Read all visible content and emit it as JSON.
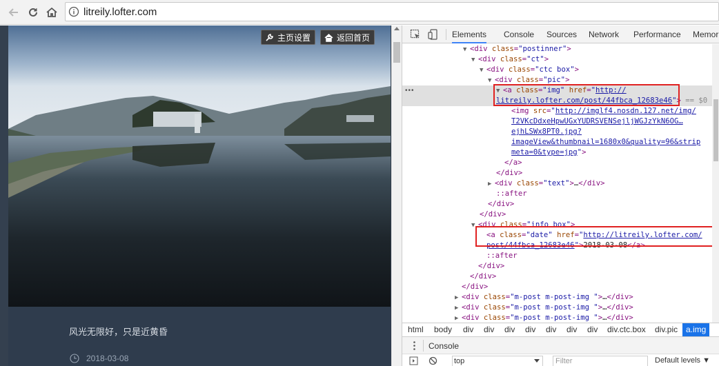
{
  "browser": {
    "url": "litreily.lofter.com"
  },
  "page": {
    "buttons": {
      "settings": "主页设置",
      "home": "返回首页"
    },
    "post_text": "风光无限好，只是近黄昏",
    "post_date": "2018-03-08"
  },
  "devtools": {
    "tabs": [
      "Elements",
      "Console",
      "Sources",
      "Network",
      "Performance",
      "Memor"
    ],
    "active_tab": "Elements",
    "dom": {
      "l1": {
        "tag": "div",
        "attr": "class",
        "val": "\"postinner\""
      },
      "l2": {
        "tag": "div",
        "attr": "class",
        "val": "\"ct\""
      },
      "l3": {
        "tag": "div",
        "attr": "class",
        "val": "\"ctc box\""
      },
      "l4": {
        "tag": "div",
        "attr": "class",
        "val": "\"pic\""
      },
      "l5": {
        "attr1": "class",
        "val1": "\"img\"",
        "attr2": "href",
        "href_a": "http://",
        "href_b": "litreily.lofter.com/post/44fbca_12683e46",
        "eq0": "== $0"
      },
      "l6": {
        "attr": "src",
        "src_a": "http://imglf4.nosdn.127.net/img/",
        "src_b": "T2VKcDdxeHpwUGxYUDRSVENSejljWGJzYkN6OG…",
        "src_c": "ejhLSWx8PT0.jpg?",
        "src_d": "imageView&thumbnail=1680x0&quality=96&strip",
        "src_e": "meta=0&type=jpg"
      },
      "l7": {
        "attr": "class",
        "val": "\"text\"",
        "ellipsis": "…"
      },
      "l8": {
        "pseudo": "::after"
      },
      "l9": {
        "attr": "class",
        "val": "\"info box\""
      },
      "l10": {
        "attr1": "class",
        "val1": "\"date\"",
        "attr2": "href",
        "href_a": "http://litreily.lofter.com/",
        "href_b": "post/44fbca_12683e46",
        "text": "2018-03-08"
      },
      "l11": {
        "pseudo": "::after"
      },
      "mpost": {
        "attr": "class",
        "val": "\"m-post m-post-img   \"",
        "ellipsis": "…"
      }
    },
    "breadcrumbs": [
      "html",
      "body",
      "div",
      "div",
      "div",
      "div",
      "div",
      "div",
      "div",
      "div.ctc.box",
      "div.pic",
      "a.img"
    ],
    "drawer_label": "Console",
    "console": {
      "context": "top",
      "filter_placeholder": "Filter",
      "levels": "Default levels ▼"
    }
  },
  "colors": {
    "highlight_box": "#e02020",
    "active_tab_underline": "#3e82f7",
    "active_crumb": "#1a73e8",
    "page_bg": "#2f3c4d"
  }
}
